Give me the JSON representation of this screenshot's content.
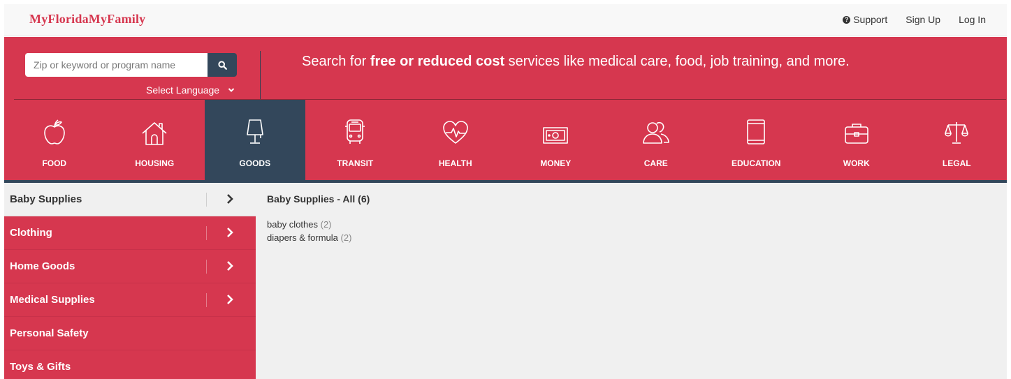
{
  "header": {
    "logo": "MyFloridaMyFamily",
    "nav": [
      {
        "label": "Support",
        "icon": "question-circle-icon"
      },
      {
        "label": "Sign Up"
      },
      {
        "label": "Log In"
      }
    ]
  },
  "search": {
    "placeholder": "Zip or keyword or program name",
    "language_label": "Select Language"
  },
  "tagline": {
    "before": "Search for ",
    "bold": "free or reduced cost",
    "after": " services like medical care, food, job training, and more."
  },
  "categories": [
    {
      "label": "FOOD",
      "icon": "apple-icon"
    },
    {
      "label": "HOUSING",
      "icon": "house-icon"
    },
    {
      "label": "GOODS",
      "icon": "lamp-icon",
      "active": true
    },
    {
      "label": "TRANSIT",
      "icon": "bus-icon"
    },
    {
      "label": "HEALTH",
      "icon": "heartbeat-icon"
    },
    {
      "label": "MONEY",
      "icon": "money-icon"
    },
    {
      "label": "CARE",
      "icon": "people-icon"
    },
    {
      "label": "EDUCATION",
      "icon": "book-icon"
    },
    {
      "label": "WORK",
      "icon": "briefcase-icon"
    },
    {
      "label": "LEGAL",
      "icon": "scales-icon"
    }
  ],
  "sidebar": {
    "items": [
      {
        "label": "Baby Supplies",
        "selected": true,
        "has_arrow": true
      },
      {
        "label": "Clothing",
        "has_arrow": true
      },
      {
        "label": "Home Goods",
        "has_arrow": true
      },
      {
        "label": "Medical Supplies",
        "has_arrow": true
      },
      {
        "label": "Personal Safety",
        "has_arrow": false
      },
      {
        "label": "Toys & Gifts",
        "has_arrow": false
      }
    ]
  },
  "main": {
    "title": "Baby Supplies - All (6)",
    "items": [
      {
        "label": "baby clothes",
        "count": "(2)"
      },
      {
        "label": "diapers & formula",
        "count": "(2)"
      }
    ]
  },
  "colors": {
    "brand_red": "#d6374f",
    "navy": "#33475b",
    "content_bg": "#f0f0f0"
  }
}
